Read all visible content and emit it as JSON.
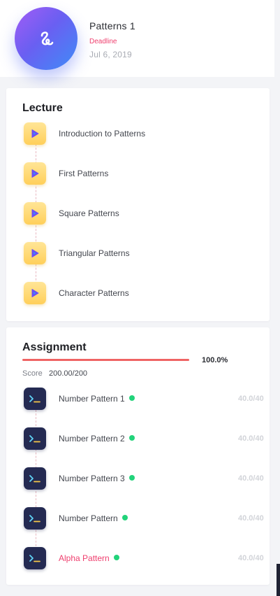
{
  "course": {
    "title": "Patterns 1",
    "deadline_label": "Deadline",
    "deadline_date": "Jul 6, 2019",
    "icon": "squiggle-logo-icon"
  },
  "lecture": {
    "title": "Lecture",
    "icon": "play-video-icon",
    "items": [
      {
        "label": "Introduction to Patterns"
      },
      {
        "label": "First Patterns"
      },
      {
        "label": "Square Patterns"
      },
      {
        "label": "Triangular Patterns"
      },
      {
        "label": "Character Patterns"
      }
    ]
  },
  "assignment": {
    "title": "Assignment",
    "progress": 1.0,
    "progress_text": "100.0%",
    "score_label": "Score",
    "score_value": "200.00/200",
    "icon": "terminal-icon",
    "items": [
      {
        "label": "Number Pattern 1",
        "score": "40.0/40",
        "completed": true
      },
      {
        "label": "Number Pattern 2",
        "score": "40.0/40",
        "completed": true
      },
      {
        "label": "Number Pattern 3",
        "score": "40.0/40",
        "completed": true
      },
      {
        "label": "Number Pattern",
        "score": "40.0/40",
        "completed": true
      },
      {
        "label": "Alpha Pattern",
        "score": "40.0/40",
        "completed": true,
        "active": true
      }
    ]
  },
  "colors": {
    "accent": "#ef3f6e",
    "progress": "#ef6464",
    "complete_dot": "#22d37a"
  }
}
